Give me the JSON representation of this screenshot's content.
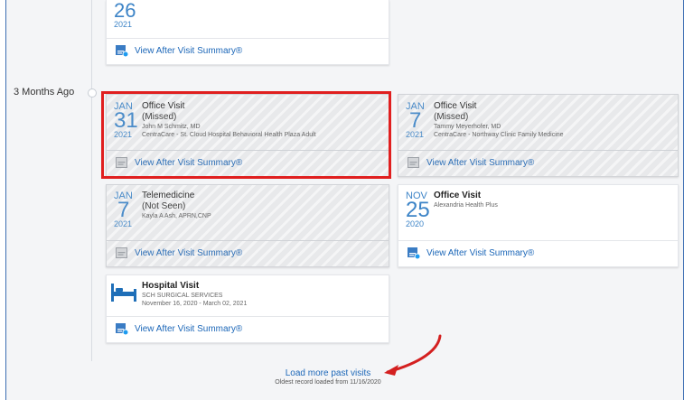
{
  "timeline": {
    "period_label": "3 Months Ago"
  },
  "cards": {
    "top": {
      "day": "26",
      "year": "2021",
      "avs_label": "View After Visit Summary®"
    },
    "jan31": {
      "month": "JAN",
      "day": "31",
      "year": "2021",
      "title": "Office Visit",
      "status": "(Missed)",
      "provider": "John M Schmitz, MD",
      "location": "CentraCare - St. Cloud Hospital Behavioral Health Plaza Adult",
      "avs_label": "View After Visit Summary®"
    },
    "jan7_office": {
      "month": "JAN",
      "day": "7",
      "year": "2021",
      "title": "Office Visit",
      "status": "(Missed)",
      "provider": "Tammy Meyerhofer, MD",
      "location": "CentraCare - Northway Clinic Family Medicine",
      "avs_label": "View After Visit Summary®"
    },
    "jan7_tele": {
      "month": "JAN",
      "day": "7",
      "year": "2021",
      "title": "Telemedicine",
      "status": "(Not Seen)",
      "provider": "Kayla A Ash, APRN,CNP",
      "avs_label": "View After Visit Summary®"
    },
    "nov25": {
      "month": "NOV",
      "day": "25",
      "year": "2020",
      "title": "Office Visit",
      "location": "Alexandria Health Plus",
      "avs_label": "View After Visit Summary®"
    },
    "hospital": {
      "title": "Hospital Visit",
      "department": "SCH SURGICAL SERVICES",
      "dates": "November 16, 2020 - March 02, 2021",
      "avs_label": "View After Visit Summary®"
    }
  },
  "load_more": {
    "label": "Load more past visits",
    "note": "Oldest record loaded from 11/16/2020"
  },
  "colors": {
    "accent": "#1c67b8",
    "highlight": "#e01f1f",
    "arrow": "#d42020"
  },
  "icons": {
    "avs": "avs-document-icon",
    "hospital": "hospital-bed-icon",
    "arrow": "arrow-annotation-icon"
  }
}
